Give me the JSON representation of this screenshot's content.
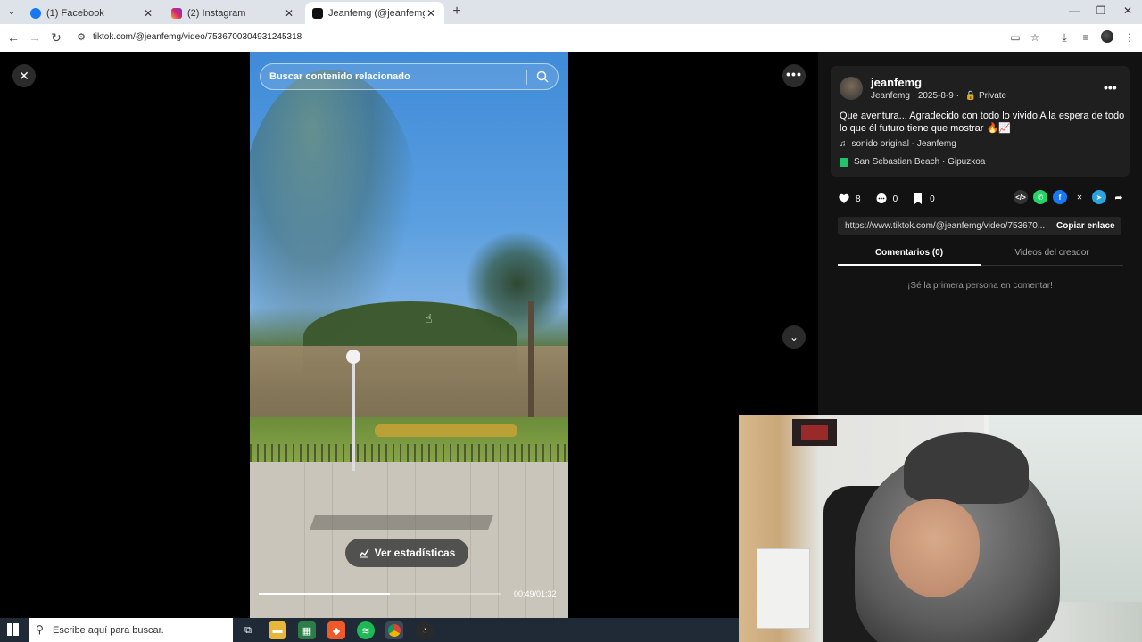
{
  "browser": {
    "tabs": [
      {
        "title": "(1) Facebook",
        "favicon": "facebook-icon",
        "active": false
      },
      {
        "title": "(2) Instagram",
        "favicon": "instagram-icon",
        "active": false
      },
      {
        "title": "Jeanfemg (@jeanfemg) | Ti",
        "favicon": "tiktok-icon",
        "active": true
      }
    ],
    "url": "tiktok.com/@jeanfemg/video/7536700304931245318"
  },
  "video": {
    "search_placeholder": "Buscar contenido relacionado",
    "stats_label": "Ver estadísticas",
    "timecode": "00:49/01:32",
    "progress": 0.54
  },
  "post": {
    "username": "jeanfemg",
    "display_name": "Jeanfemg",
    "date": "2025-8-9",
    "privacy": "Private",
    "description": "Que aventura... Agradecido con todo lo vivido A la espera de todo lo que él futuro tiene que mostrar 🔥📈",
    "sound": "sonido original - Jeanfemg",
    "location": "San Sebastian Beach · Gipuzkoa",
    "likes": "8",
    "comments": "0",
    "saves": "0",
    "link": "https://www.tiktok.com/@jeanfemg/video/753670...",
    "copy_link_label": "Copiar enlace",
    "tabs": [
      "Comentarios (0)",
      "Videos del creador"
    ],
    "empty_comments": "¡Sé la primera persona en comentar!"
  },
  "taskbar": {
    "search_placeholder": "Escribe aquí para buscar."
  },
  "colors": {
    "accent_green": "#22c36a",
    "whatsapp": "#25d366",
    "facebook": "#1877f2",
    "telegram": "#2aa3df"
  }
}
